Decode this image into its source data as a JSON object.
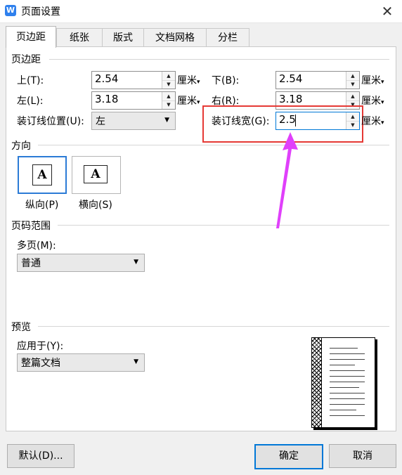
{
  "window": {
    "title": "页面设置",
    "app_icon": "W"
  },
  "tabs": [
    {
      "label": "页边距",
      "active": true
    },
    {
      "label": "纸张"
    },
    {
      "label": "版式"
    },
    {
      "label": "文档网格"
    },
    {
      "label": "分栏"
    }
  ],
  "margins": {
    "group_label": "页边距",
    "top_label": "上(T):",
    "top_value": "2.54",
    "bottom_label": "下(B):",
    "bottom_value": "2.54",
    "left_label": "左(L):",
    "left_value": "3.18",
    "right_label": "右(R):",
    "right_value": "3.18",
    "gutter_pos_label": "装订线位置(U):",
    "gutter_pos_value": "左",
    "gutter_width_label": "装订线宽(G):",
    "gutter_width_value": "2.5",
    "unit": "厘米"
  },
  "orientation": {
    "group_label": "方向",
    "portrait_label": "纵向(P)",
    "landscape_label": "横向(S)",
    "icon_glyph": "A",
    "selected": "portrait"
  },
  "page_range": {
    "group_label": "页码范围",
    "multi_label": "多页(M):",
    "multi_value": "普通"
  },
  "preview": {
    "group_label": "预览",
    "apply_label": "应用于(Y):",
    "apply_value": "整篇文档"
  },
  "buttons": {
    "default": "默认(D)...",
    "ok": "确定",
    "cancel": "取消"
  },
  "colors": {
    "highlight": "#e53935",
    "arrow": "#e040fb",
    "accent": "#0078d7"
  }
}
